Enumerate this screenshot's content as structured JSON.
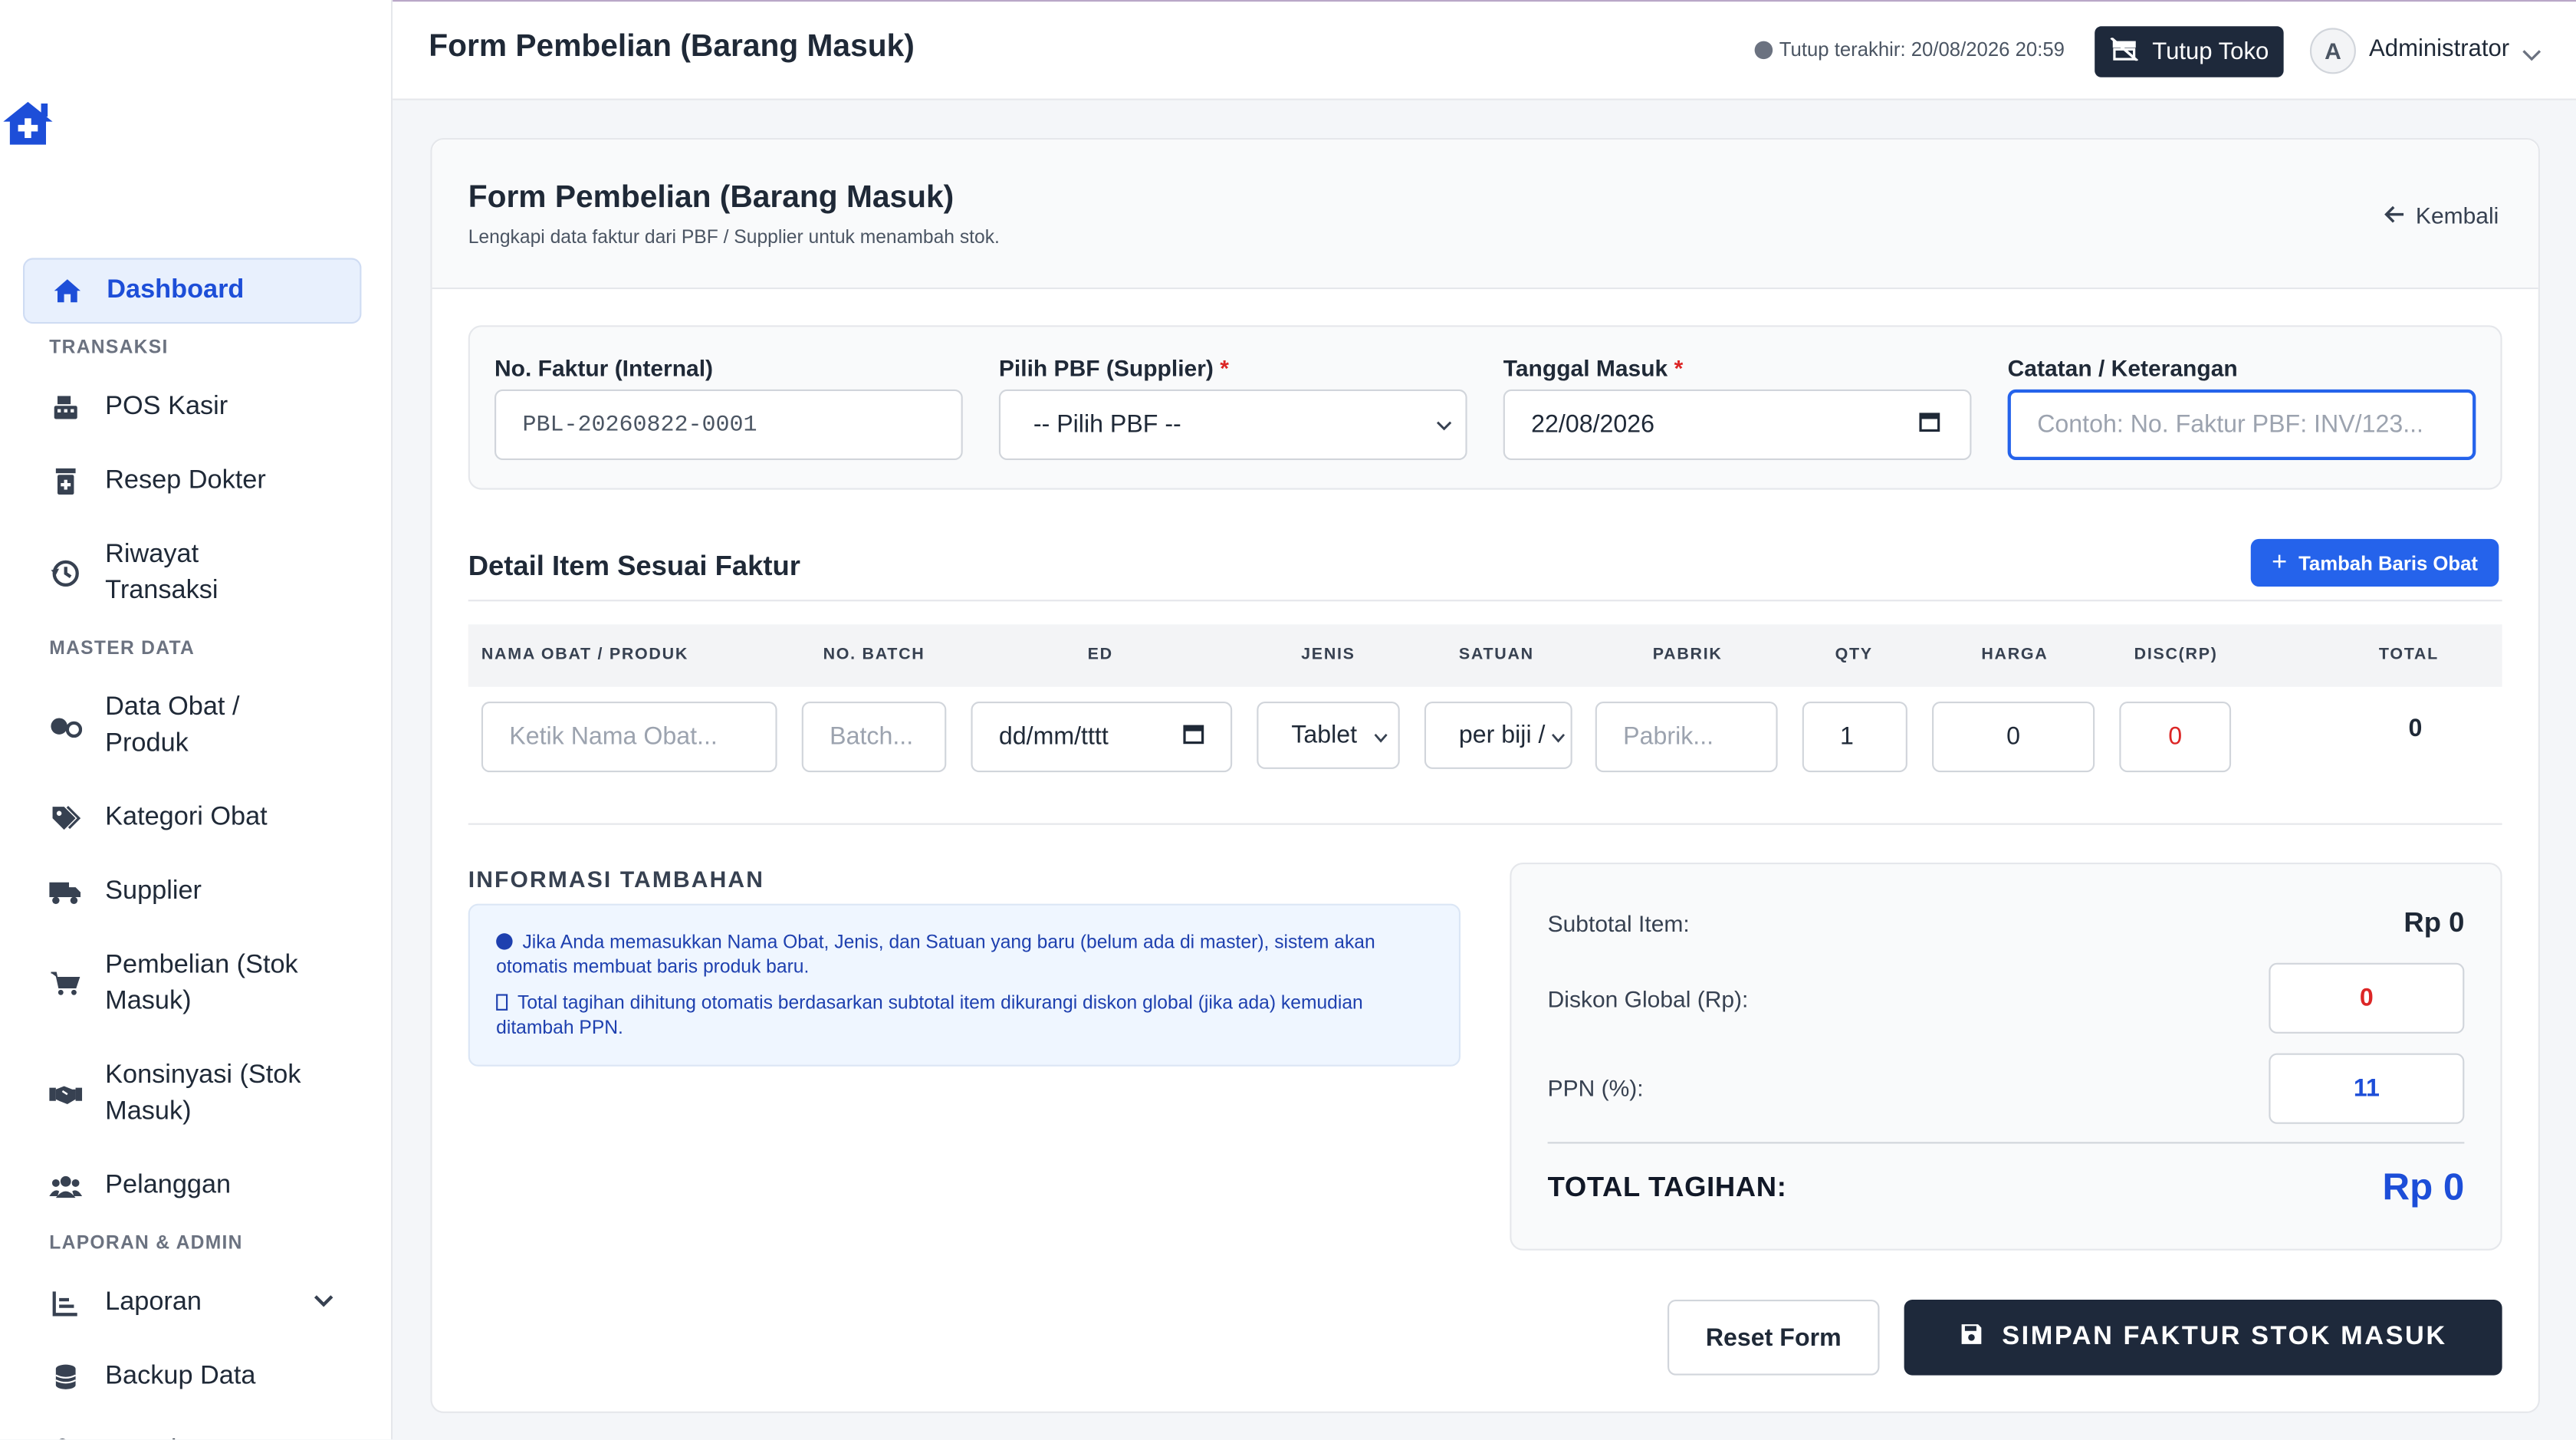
{
  "topbar": {
    "title": "Form Pembelian (Barang Masuk)",
    "last_close": "Tutup terakhir: 20/08/2026 20:59",
    "close_store_label": "Tutup Toko",
    "avatar_initial": "A",
    "username": "Administrator"
  },
  "sidebar": {
    "dashboard": "Dashboard",
    "section_transaksi": "TRANSAKSI",
    "pos_kasir": "POS Kasir",
    "resep_dokter": "Resep Dokter",
    "riwayat_transaksi": "Riwayat Transaksi",
    "section_master": "MASTER DATA",
    "data_obat": "Data Obat / Produk",
    "kategori_obat": "Kategori Obat",
    "supplier": "Supplier",
    "pembelian": "Pembelian (Stok Masuk)",
    "konsinyasi": "Konsinyasi (Stok Masuk)",
    "pelanggan": "Pelanggan",
    "section_laporan": "LAPORAN & ADMIN",
    "laporan": "Laporan",
    "backup_data": "Backup Data",
    "manajemen_user": "Manajemen User"
  },
  "card": {
    "title": "Form Pembelian (Barang Masuk)",
    "subtitle": "Lengkapi data faktur dari PBF / Supplier untuk menambah stok.",
    "back_label": "Kembali"
  },
  "form": {
    "faktur_label": "No. Faktur (Internal)",
    "faktur_value": "PBL-20260822-0001",
    "pbf_label": "Pilih PBF (Supplier)",
    "pbf_value": "-- Pilih PBF --",
    "tanggal_label": "Tanggal Masuk",
    "tanggal_value": "22/08/2026",
    "catatan_label": "Catatan / Keterangan",
    "catatan_placeholder": "Contoh: No. Faktur PBF: INV/123...",
    "required_mark": "*"
  },
  "detail": {
    "title": "Detail Item Sesuai Faktur",
    "add_row_label": "Tambah Baris Obat",
    "columns": [
      "NAMA OBAT / PRODUK",
      "NO. BATCH",
      "ED",
      "JENIS",
      "SATUAN",
      "PABRIK",
      "QTY",
      "HARGA",
      "DISC(RP)",
      "TOTAL"
    ],
    "row": {
      "nama_placeholder": "Ketik Nama Obat...",
      "batch_placeholder": "Batch...",
      "ed_placeholder": "dd/mm/tttt",
      "jenis_value": "Tablet",
      "satuan_value": "per biji /",
      "pabrik_placeholder": "Pabrik...",
      "qty_value": "1",
      "harga_value": "0",
      "disc_value": "0",
      "total_value": "0"
    }
  },
  "extra": {
    "title": "INFORMASI TAMBAHAN",
    "note1": "Jika Anda memasukkan Nama Obat, Jenis, dan Satuan yang baru (belum ada di master), sistem akan otomatis membuat baris produk baru.",
    "note2": "Total tagihan dihitung otomatis berdasarkan subtotal item dikurangi diskon global (jika ada) kemudian ditambah PPN."
  },
  "summary": {
    "subtotal_label": "Subtotal Item:",
    "subtotal_value": "Rp 0",
    "diskon_label": "Diskon Global (Rp):",
    "diskon_value": "0",
    "ppn_label": "PPN (%):",
    "ppn_value": "11",
    "total_label": "TOTAL TAGIHAN:",
    "total_value": "Rp 0"
  },
  "actions": {
    "reset_label": "Reset Form",
    "save_label": "SIMPAN FAKTUR STOK MASUK"
  },
  "colors": {
    "primary": "#2563eb",
    "dark": "#1e293b",
    "danger": "#dc2626"
  }
}
